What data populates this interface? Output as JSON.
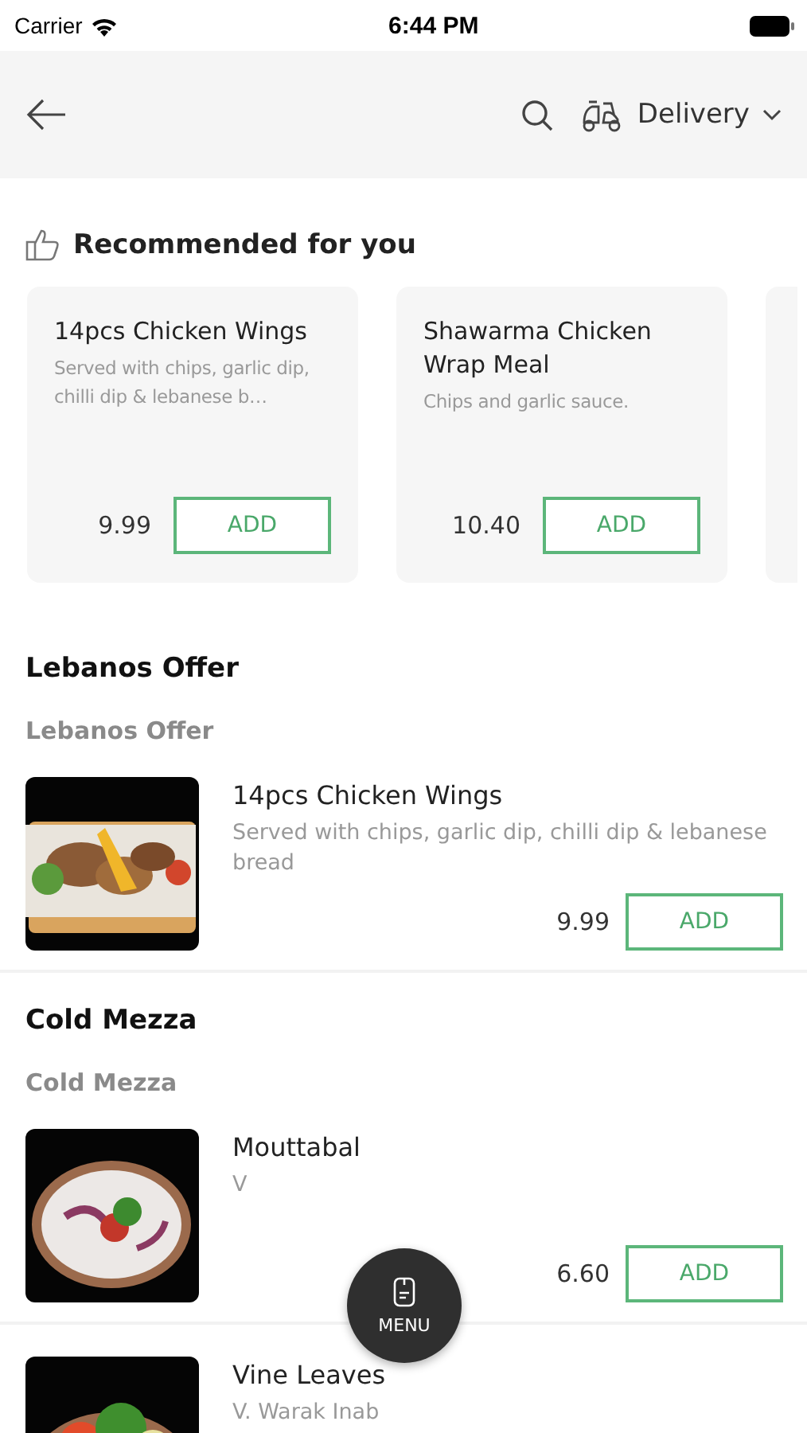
{
  "status_bar": {
    "carrier": "Carrier",
    "time": "6:44 PM"
  },
  "header": {
    "order_mode": "Delivery"
  },
  "recommended": {
    "title": "Recommended for you",
    "items": [
      {
        "name": "14pcs Chicken Wings",
        "description": "Served with chips, garlic dip, chilli dip & lebanese b…",
        "price": "9.99",
        "button": "ADD"
      },
      {
        "name": "Shawarma Chicken Wrap Meal",
        "description": "Chips and garlic sauce.",
        "price": "10.40",
        "button": "ADD"
      }
    ]
  },
  "sections": [
    {
      "title": "Lebanos Offer",
      "subtitle": "Lebanos Offer",
      "items": [
        {
          "name": "14pcs Chicken Wings",
          "description": "Served with chips, garlic dip, chilli dip & lebanese bread",
          "price": "9.99",
          "button": "ADD"
        }
      ]
    },
    {
      "title": "Cold Mezza",
      "subtitle": "Cold Mezza",
      "items": [
        {
          "name": "Mouttabal",
          "description": "V",
          "price": "6.60",
          "button": "ADD"
        },
        {
          "name": "Vine Leaves",
          "description": "V. Warak Inab"
        }
      ]
    }
  ],
  "menu_button": {
    "label": "MENU"
  }
}
